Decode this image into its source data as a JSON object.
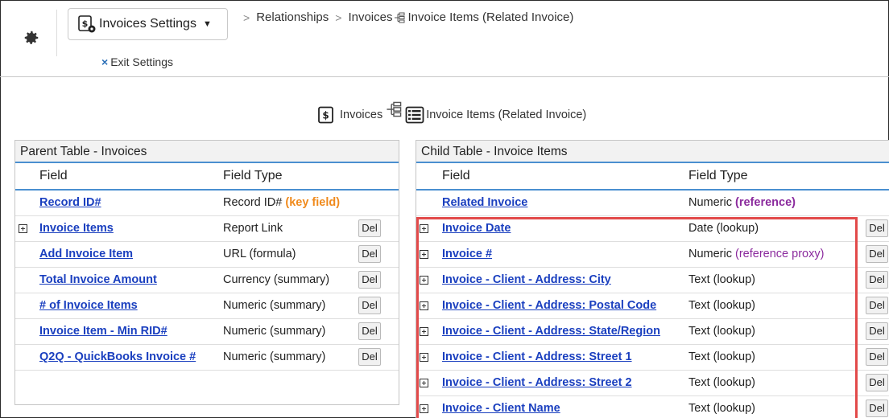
{
  "header": {
    "settings_label": "Invoices Settings",
    "exit_label": "Exit Settings",
    "breadcrumb": {
      "relationships": "Relationships",
      "invoices": "Invoices",
      "invoice_items": "Invoice Items (Related Invoice)"
    }
  },
  "relation": {
    "parent": "Invoices",
    "child": "Invoice Items (Related Invoice)"
  },
  "parent_table": {
    "title": "Parent Table - Invoices",
    "headers": {
      "field": "Field",
      "type": "Field Type"
    },
    "rows": [
      {
        "field": "Record ID#",
        "type": "Record ID#",
        "type_extra": "(key field)",
        "expand": false,
        "del": false
      },
      {
        "field": "Invoice Items",
        "type": "Report Link",
        "expand": true,
        "del": true
      },
      {
        "field": "Add Invoice Item",
        "type": "URL (formula)",
        "expand": false,
        "del": true
      },
      {
        "field": "Total Invoice Amount",
        "type": "Currency (summary)",
        "expand": false,
        "del": true
      },
      {
        "field": "# of Invoice Items",
        "type": "Numeric (summary)",
        "expand": false,
        "del": true
      },
      {
        "field": "Invoice Item - Min RID#",
        "type": "Numeric (summary)",
        "expand": false,
        "del": true
      },
      {
        "field": "Q2Q - QuickBooks Invoice #",
        "type": "Numeric (summary)",
        "expand": false,
        "del": true
      }
    ]
  },
  "child_table": {
    "title": "Child Table - Invoice Items",
    "headers": {
      "field": "Field",
      "type": "Field Type"
    },
    "rows": [
      {
        "field": "Related Invoice",
        "type": "Numeric",
        "type_extra": "(reference)",
        "expand": false,
        "del": false
      },
      {
        "field": "Invoice Date",
        "type": "Date (lookup)",
        "expand": true,
        "del": true
      },
      {
        "field": "Invoice #",
        "type": "Numeric",
        "type_extra": "(reference proxy)",
        "expand": true,
        "del": true
      },
      {
        "field": "Invoice - Client - Address: City",
        "type": "Text (lookup)",
        "expand": true,
        "del": true
      },
      {
        "field": "Invoice - Client - Address: Postal Code",
        "type": "Text (lookup)",
        "expand": true,
        "del": true
      },
      {
        "field": "Invoice - Client - Address: State/Region",
        "type": "Text (lookup)",
        "expand": true,
        "del": true
      },
      {
        "field": "Invoice - Client - Address: Street 1",
        "type": "Text (lookup)",
        "expand": true,
        "del": true
      },
      {
        "field": "Invoice - Client - Address: Street 2",
        "type": "Text (lookup)",
        "expand": true,
        "del": true
      },
      {
        "field": "Invoice - Client Name",
        "type": "Text (lookup)",
        "expand": true,
        "del": true
      }
    ]
  },
  "del_label": "Del",
  "colors": {
    "link": "#1a3fbf",
    "accent_blue": "#4a8fd0",
    "key_field": "#f08a1c",
    "reference": "#8b2a9d",
    "highlight": "#e24a4a"
  }
}
